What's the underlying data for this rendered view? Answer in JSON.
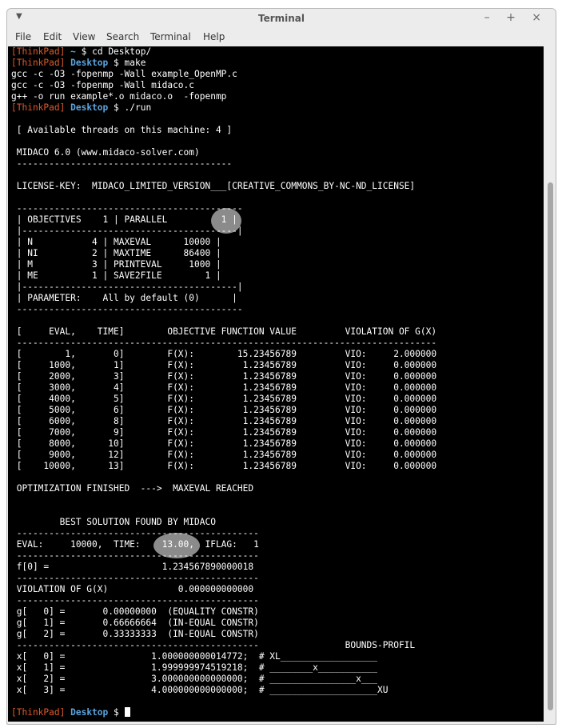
{
  "window": {
    "title": "Terminal",
    "controls": "–  +  ×"
  },
  "menu": [
    "File",
    "Edit",
    "View",
    "Search",
    "Terminal",
    "Help"
  ],
  "prompt": {
    "host": "[ThinkPad]",
    "home": "~",
    "desktop": "Desktop",
    "symbol": "$"
  },
  "commands": {
    "cd": "cd Desktop/",
    "make": "make",
    "run": "./run"
  },
  "make_output": [
    "gcc -c -O3 -fopenmp -Wall example_OpenMP.c",
    "gcc -c -O3 -fopenmp -Wall midaco.c",
    "g++ -o run example*.o midaco.o  -fopenmp"
  ],
  "lines": [
    " [ Available threads on this machine: 4 ]",
    "",
    " MIDACO 6.0 (www.midaco-solver.com)",
    " ----------------------------------------",
    "",
    " LICENSE-KEY:  MIDACO_LIMITED_VERSION___[CREATIVE_COMMONS_BY-NC-ND_LICENSE]",
    "",
    " ------------------------------------------",
    " | OBJECTIVES    1 | PARALLEL          1 |",
    " |----------------------------------------|",
    " | N           4 | MAXEVAL      10000 |",
    " | NI          2 | MAXTIME      86400 |",
    " | M           3 | PRINTEVAL     1000 |",
    " | ME          1 | SAVE2FILE        1 |",
    " |----------------------------------------|",
    " | PARAMETER:    All by default (0)      |",
    " ------------------------------------------",
    "",
    " [     EVAL,    TIME]        OBJECTIVE FUNCTION VALUE         VIOLATION OF G(X)",
    " ------------------------------------------------------------------------------",
    " [        1,       0]        F(X):        15.23456789         VIO:     2.000000",
    " [     1000,       1]        F(X):         1.23456789         VIO:     0.000000",
    " [     2000,       3]        F(X):         1.23456789         VIO:     0.000000",
    " [     3000,       4]        F(X):         1.23456789         VIO:     0.000000",
    " [     4000,       5]        F(X):         1.23456789         VIO:     0.000000",
    " [     5000,       6]        F(X):         1.23456789         VIO:     0.000000",
    " [     6000,       8]        F(X):         1.23456789         VIO:     0.000000",
    " [     7000,       9]        F(X):         1.23456789         VIO:     0.000000",
    " [     8000,      10]        F(X):         1.23456789         VIO:     0.000000",
    " [     9000,      12]        F(X):         1.23456789         VIO:     0.000000",
    " [    10000,      13]        F(X):         1.23456789         VIO:     0.000000",
    "",
    " OPTIMIZATION FINISHED  --->  MAXEVAL REACHED",
    "",
    "",
    "         BEST SOLUTION FOUND BY MIDACO",
    " ---------------------------------------------",
    " EVAL:     10000,  TIME:    13.00,  IFLAG:   1",
    " ---------------------------------------------",
    " f[0] =                     1.234567890000018",
    " ---------------------------------------------",
    " VIOLATION OF G(X)             0.000000000000",
    " ---------------------------------------------",
    " g[   0] =       0.00000000  (EQUALITY CONSTR)",
    " g[   1] =       0.66666664  (IN-EQUAL CONSTR)",
    " g[   2] =       0.33333333  (IN-EQUAL CONSTR)",
    " ---------------------------------------------                BOUNDS-PROFIL",
    " x[   0] =                1.000000000014772;  # XL__________________",
    " x[   1] =                1.999999974519218;  # ________x___________",
    " x[   2] =                3.000000000000000;  # ________________x___",
    " x[   3] =                4.000000000000000;  # ____________________XU"
  ]
}
